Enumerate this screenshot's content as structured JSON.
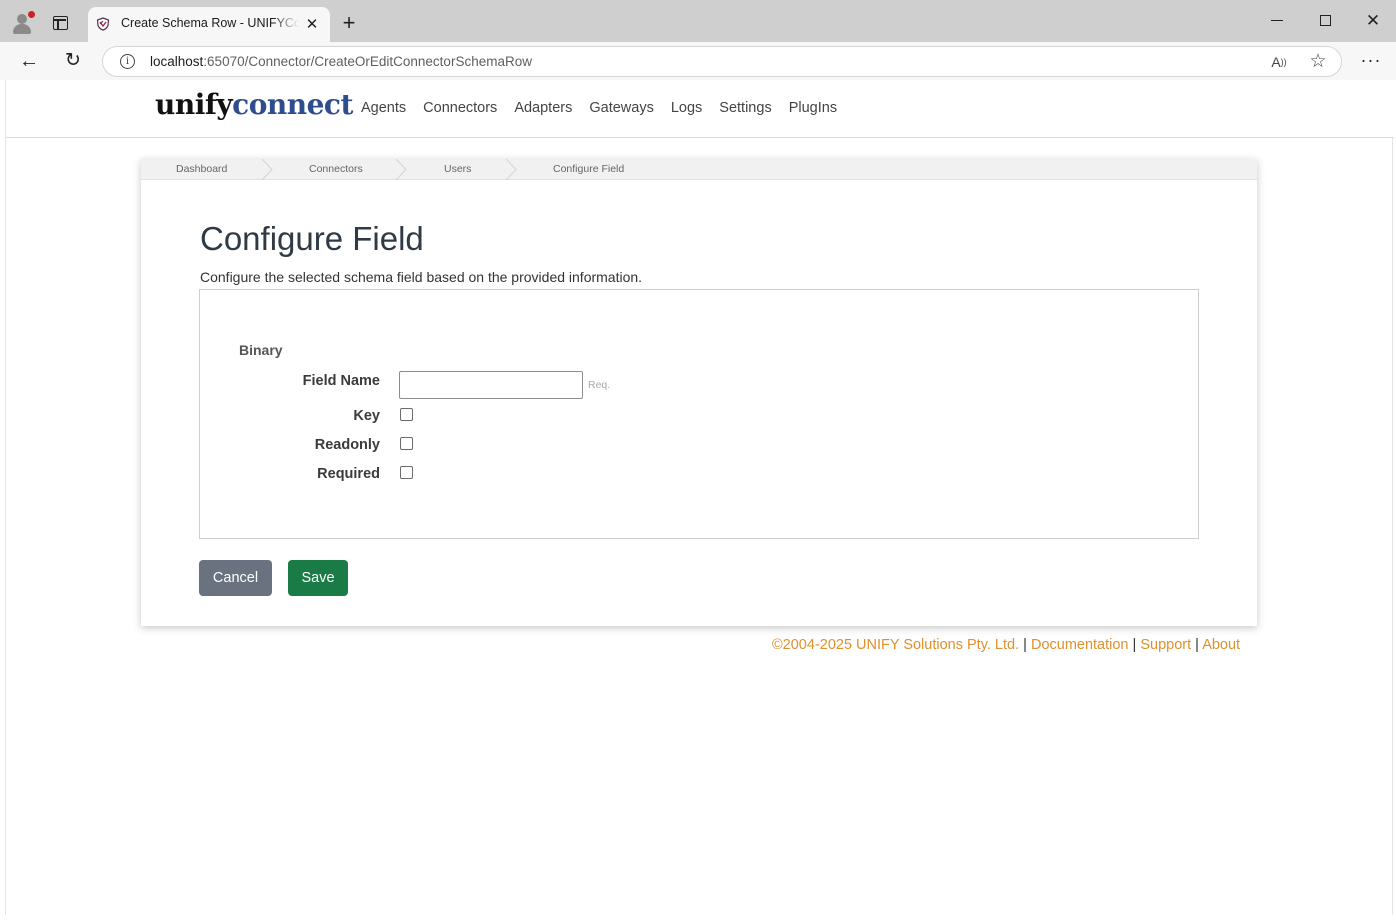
{
  "browser": {
    "tab_title": "Create Schema Row - UNIFYConnect",
    "url_host": "localhost",
    "url_rest": ":65070/Connector/CreateOrEditConnectorSchemaRow",
    "icons": [
      "profile-icon",
      "tabs-icon",
      "close-icon",
      "plus-icon",
      "minimize-icon",
      "maximize-icon",
      "back-icon",
      "reload-icon",
      "info-icon",
      "read-aloud-icon",
      "star-icon",
      "more-icon"
    ]
  },
  "header": {
    "logo_part1": "unify",
    "logo_part2": "connect",
    "nav": [
      "Agents",
      "Connectors",
      "Adapters",
      "Gateways",
      "Logs",
      "Settings",
      "PlugIns"
    ]
  },
  "breadcrumb": [
    "Dashboard",
    "Connectors",
    "Users",
    "Configure Field"
  ],
  "page": {
    "title": "Configure Field",
    "description": "Configure the selected schema field based on the provided information."
  },
  "form": {
    "section": "Binary",
    "field_name_label": "Field Name",
    "field_name_value": "",
    "req_hint": "Req.",
    "key_label": "Key",
    "readonly_label": "Readonly",
    "required_label": "Required",
    "key_checked": false,
    "readonly_checked": false,
    "required_checked": false
  },
  "buttons": {
    "cancel": "Cancel",
    "save": "Save"
  },
  "footer": {
    "copyright": "©2004-2025 UNIFY Solutions Pty. Ltd.",
    "sep": "|",
    "documentation": "Documentation",
    "support": "Support",
    "about": "About"
  },
  "colors": {
    "logo_accent": "#2f4c8f",
    "save_button": "#1a7b47",
    "cancel_button": "#6a7280",
    "footer_link": "#e0902c"
  }
}
